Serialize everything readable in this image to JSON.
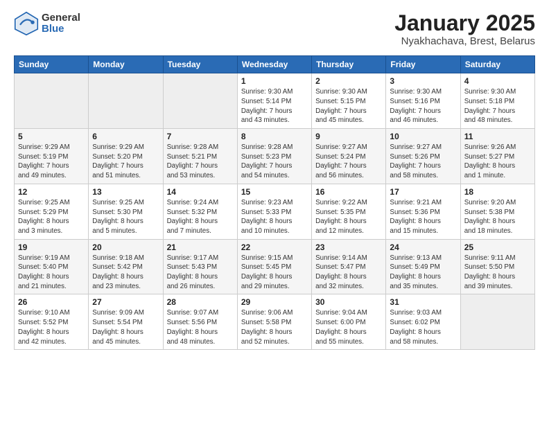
{
  "header": {
    "logo_general": "General",
    "logo_blue": "Blue",
    "title": "January 2025",
    "location": "Nyakhachava, Brest, Belarus"
  },
  "weekdays": [
    "Sunday",
    "Monday",
    "Tuesday",
    "Wednesday",
    "Thursday",
    "Friday",
    "Saturday"
  ],
  "weeks": [
    [
      {
        "day": "",
        "info": ""
      },
      {
        "day": "",
        "info": ""
      },
      {
        "day": "",
        "info": ""
      },
      {
        "day": "1",
        "info": "Sunrise: 9:30 AM\nSunset: 5:14 PM\nDaylight: 7 hours\nand 43 minutes."
      },
      {
        "day": "2",
        "info": "Sunrise: 9:30 AM\nSunset: 5:15 PM\nDaylight: 7 hours\nand 45 minutes."
      },
      {
        "day": "3",
        "info": "Sunrise: 9:30 AM\nSunset: 5:16 PM\nDaylight: 7 hours\nand 46 minutes."
      },
      {
        "day": "4",
        "info": "Sunrise: 9:30 AM\nSunset: 5:18 PM\nDaylight: 7 hours\nand 48 minutes."
      }
    ],
    [
      {
        "day": "5",
        "info": "Sunrise: 9:29 AM\nSunset: 5:19 PM\nDaylight: 7 hours\nand 49 minutes."
      },
      {
        "day": "6",
        "info": "Sunrise: 9:29 AM\nSunset: 5:20 PM\nDaylight: 7 hours\nand 51 minutes."
      },
      {
        "day": "7",
        "info": "Sunrise: 9:28 AM\nSunset: 5:21 PM\nDaylight: 7 hours\nand 53 minutes."
      },
      {
        "day": "8",
        "info": "Sunrise: 9:28 AM\nSunset: 5:23 PM\nDaylight: 7 hours\nand 54 minutes."
      },
      {
        "day": "9",
        "info": "Sunrise: 9:27 AM\nSunset: 5:24 PM\nDaylight: 7 hours\nand 56 minutes."
      },
      {
        "day": "10",
        "info": "Sunrise: 9:27 AM\nSunset: 5:26 PM\nDaylight: 7 hours\nand 58 minutes."
      },
      {
        "day": "11",
        "info": "Sunrise: 9:26 AM\nSunset: 5:27 PM\nDaylight: 8 hours\nand 1 minute."
      }
    ],
    [
      {
        "day": "12",
        "info": "Sunrise: 9:25 AM\nSunset: 5:29 PM\nDaylight: 8 hours\nand 3 minutes."
      },
      {
        "day": "13",
        "info": "Sunrise: 9:25 AM\nSunset: 5:30 PM\nDaylight: 8 hours\nand 5 minutes."
      },
      {
        "day": "14",
        "info": "Sunrise: 9:24 AM\nSunset: 5:32 PM\nDaylight: 8 hours\nand 7 minutes."
      },
      {
        "day": "15",
        "info": "Sunrise: 9:23 AM\nSunset: 5:33 PM\nDaylight: 8 hours\nand 10 minutes."
      },
      {
        "day": "16",
        "info": "Sunrise: 9:22 AM\nSunset: 5:35 PM\nDaylight: 8 hours\nand 12 minutes."
      },
      {
        "day": "17",
        "info": "Sunrise: 9:21 AM\nSunset: 5:36 PM\nDaylight: 8 hours\nand 15 minutes."
      },
      {
        "day": "18",
        "info": "Sunrise: 9:20 AM\nSunset: 5:38 PM\nDaylight: 8 hours\nand 18 minutes."
      }
    ],
    [
      {
        "day": "19",
        "info": "Sunrise: 9:19 AM\nSunset: 5:40 PM\nDaylight: 8 hours\nand 21 minutes."
      },
      {
        "day": "20",
        "info": "Sunrise: 9:18 AM\nSunset: 5:42 PM\nDaylight: 8 hours\nand 23 minutes."
      },
      {
        "day": "21",
        "info": "Sunrise: 9:17 AM\nSunset: 5:43 PM\nDaylight: 8 hours\nand 26 minutes."
      },
      {
        "day": "22",
        "info": "Sunrise: 9:15 AM\nSunset: 5:45 PM\nDaylight: 8 hours\nand 29 minutes."
      },
      {
        "day": "23",
        "info": "Sunrise: 9:14 AM\nSunset: 5:47 PM\nDaylight: 8 hours\nand 32 minutes."
      },
      {
        "day": "24",
        "info": "Sunrise: 9:13 AM\nSunset: 5:49 PM\nDaylight: 8 hours\nand 35 minutes."
      },
      {
        "day": "25",
        "info": "Sunrise: 9:11 AM\nSunset: 5:50 PM\nDaylight: 8 hours\nand 39 minutes."
      }
    ],
    [
      {
        "day": "26",
        "info": "Sunrise: 9:10 AM\nSunset: 5:52 PM\nDaylight: 8 hours\nand 42 minutes."
      },
      {
        "day": "27",
        "info": "Sunrise: 9:09 AM\nSunset: 5:54 PM\nDaylight: 8 hours\nand 45 minutes."
      },
      {
        "day": "28",
        "info": "Sunrise: 9:07 AM\nSunset: 5:56 PM\nDaylight: 8 hours\nand 48 minutes."
      },
      {
        "day": "29",
        "info": "Sunrise: 9:06 AM\nSunset: 5:58 PM\nDaylight: 8 hours\nand 52 minutes."
      },
      {
        "day": "30",
        "info": "Sunrise: 9:04 AM\nSunset: 6:00 PM\nDaylight: 8 hours\nand 55 minutes."
      },
      {
        "day": "31",
        "info": "Sunrise: 9:03 AM\nSunset: 6:02 PM\nDaylight: 8 hours\nand 58 minutes."
      },
      {
        "day": "",
        "info": ""
      }
    ]
  ]
}
